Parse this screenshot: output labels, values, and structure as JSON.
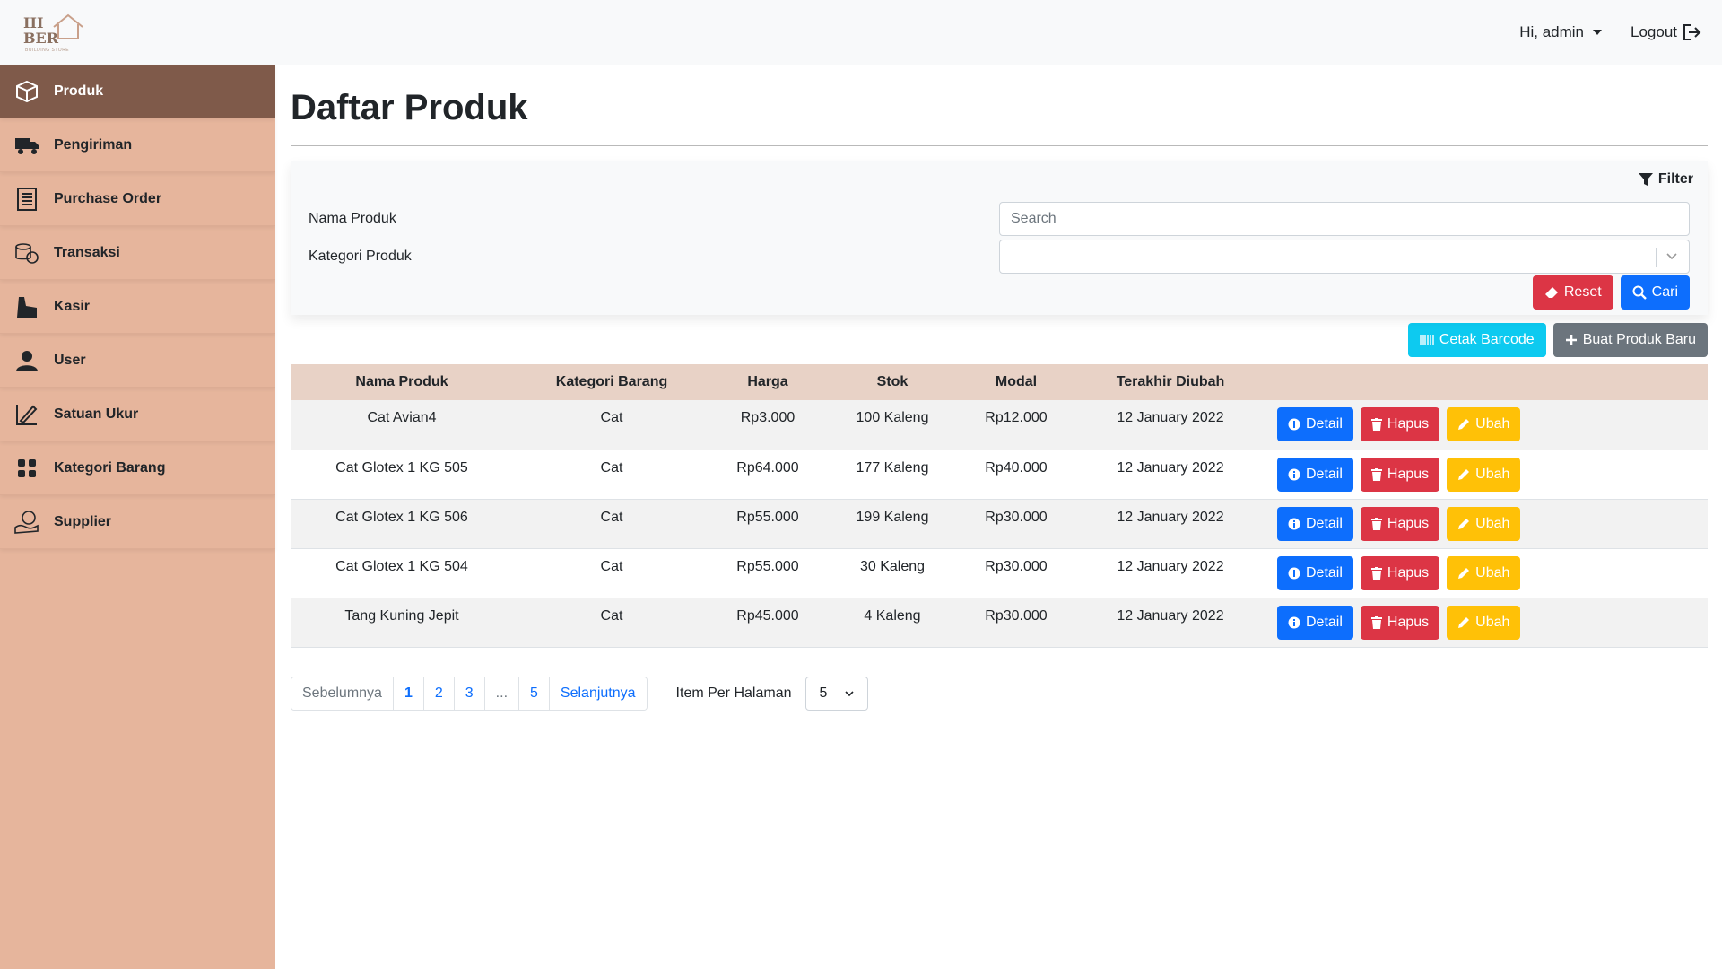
{
  "brand": {
    "logo_text": "BER",
    "logo_top": "III",
    "logo_sub": "BUILDING STORE",
    "logo_color": "#8a7060"
  },
  "header": {
    "greeting": "Hi, admin",
    "logout_label": "Logout"
  },
  "sidebar": {
    "items": [
      {
        "label": "Produk",
        "icon": "box-icon",
        "active": true
      },
      {
        "label": "Pengiriman",
        "icon": "truck-icon"
      },
      {
        "label": "Purchase Order",
        "icon": "document-list-icon"
      },
      {
        "label": "Transaksi",
        "icon": "coins-icon"
      },
      {
        "label": "Kasir",
        "icon": "cashier-icon"
      },
      {
        "label": "User",
        "icon": "user-icon"
      },
      {
        "label": "Satuan Ukur",
        "icon": "ruler-pencil-icon"
      },
      {
        "label": "Kategori Barang",
        "icon": "grid-icon"
      },
      {
        "label": "Supplier",
        "icon": "supplier-icon"
      }
    ],
    "background": "#e6b59c",
    "active_background": "#7f5a4a"
  },
  "page": {
    "title": "Daftar Produk"
  },
  "filter": {
    "heading": "Filter",
    "nama_label": "Nama Produk",
    "nama_placeholder": "Search",
    "nama_value": "",
    "kategori_label": "Kategori Produk",
    "kategori_value": "",
    "reset_label": "Reset",
    "cari_label": "Cari"
  },
  "toolbar": {
    "barcode_label": "Cetak Barcode",
    "new_label": "Buat Produk Baru"
  },
  "table": {
    "columns": [
      "Nama Produk",
      "Kategori Barang",
      "Harga",
      "Stok",
      "Modal",
      "Terakhir Diubah"
    ],
    "rows": [
      {
        "nama": "Cat Avian4",
        "kategori": "Cat",
        "harga": "Rp3.000",
        "stok": "100 Kaleng",
        "modal": "Rp12.000",
        "diubah": "12 January 2022"
      },
      {
        "nama": "Cat Glotex 1 KG 505",
        "kategori": "Cat",
        "harga": "Rp64.000",
        "stok": "177 Kaleng",
        "modal": "Rp40.000",
        "diubah": "12 January 2022"
      },
      {
        "nama": "Cat Glotex 1 KG 506",
        "kategori": "Cat",
        "harga": "Rp55.000",
        "stok": "199 Kaleng",
        "modal": "Rp30.000",
        "diubah": "12 January 2022"
      },
      {
        "nama": "Cat Glotex 1 KG 504",
        "kategori": "Cat",
        "harga": "Rp55.000",
        "stok": "30 Kaleng",
        "modal": "Rp30.000",
        "diubah": "12 January 2022"
      },
      {
        "nama": "Tang Kuning Jepit",
        "kategori": "Cat",
        "harga": "Rp45.000",
        "stok": "4 Kaleng",
        "modal": "Rp30.000",
        "diubah": "12 January 2022"
      }
    ],
    "actions": {
      "detail": "Detail",
      "hapus": "Hapus",
      "ubah": "Ubah"
    },
    "header_background": "#e8d2c6"
  },
  "pagination": {
    "prev_label": "Sebelumnya",
    "pages": [
      "1",
      "2",
      "3",
      "...",
      "5"
    ],
    "current": "1",
    "next_label": "Selanjutnya",
    "per_page_label": "Item Per Halaman",
    "per_page_value": "5"
  }
}
